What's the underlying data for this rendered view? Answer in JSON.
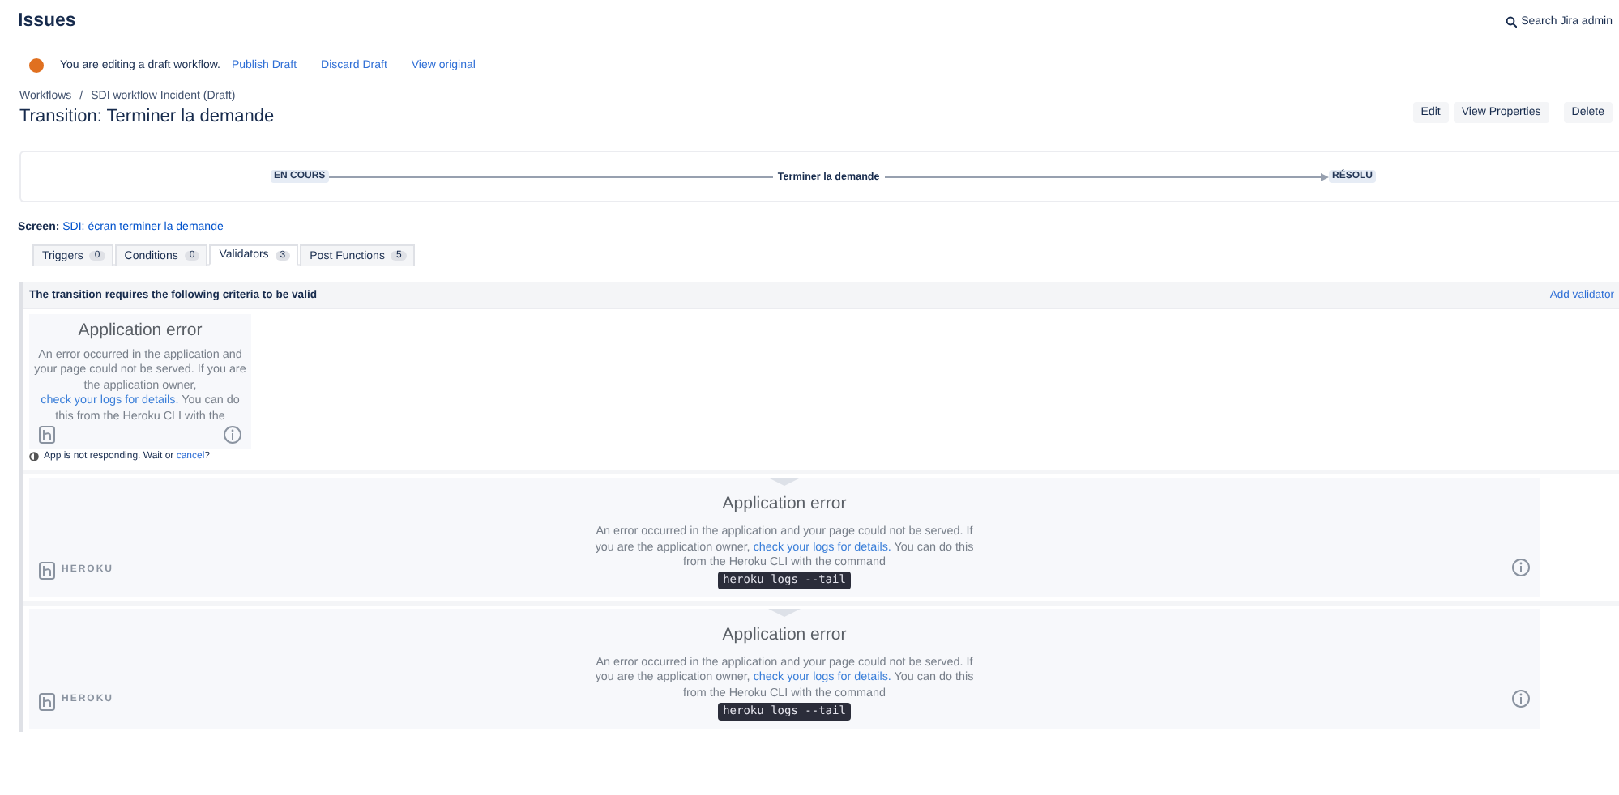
{
  "header": {
    "title": "Issues",
    "search": "Search Jira admin"
  },
  "draft_banner": {
    "message": "You are editing a draft workflow.",
    "actions": [
      "Publish Draft",
      "Discard Draft",
      "View original"
    ]
  },
  "breadcrumbs": {
    "separator": "/",
    "items": [
      "Workflows",
      "SDI workflow Incident (Draft)"
    ]
  },
  "page_title": "Transition: Terminer la demande",
  "actions": [
    "Edit",
    "View Properties",
    "Delete"
  ],
  "transition": {
    "from": "EN COURS",
    "label": "Terminer la demande",
    "to": "RÉSOLU"
  },
  "screen": {
    "label": "Screen:",
    "value": "SDI: écran terminer la demande"
  },
  "tabs": [
    {
      "label": "Triggers",
      "count": "0",
      "selected": false
    },
    {
      "label": "Conditions",
      "count": "0",
      "selected": false
    },
    {
      "label": "Validators",
      "count": "3",
      "selected": true
    },
    {
      "label": "Post Functions",
      "count": "5",
      "selected": false
    }
  ],
  "validators": {
    "heading": "The transition requires the following criteria to be valid",
    "add_link": "Add validator",
    "panels": [
      {
        "kind": "compact",
        "title": "Application error",
        "text": "An error occurred in the application and your page could not be served. If you are the application owner,",
        "link": "check your logs for details.",
        "text_after": "You can do this from the Heroku CLI with the"
      },
      {
        "kind": "full",
        "title": "Application error",
        "text": "An error occurred in the application and your page could not be served. If you are the application owner,",
        "link": "check your logs for details.",
        "text_after": "You can do this from the Heroku CLI with the command",
        "command": "heroku logs --tail",
        "brand": "HEROKU"
      },
      {
        "kind": "full",
        "title": "Application error",
        "text": "An error occurred in the application and your page could not be served. If you are the application owner,",
        "link": "check your logs for details.",
        "text_after": "You can do this from the Heroku CLI with the command",
        "command": "heroku logs --tail",
        "brand": "HEROKU"
      }
    ],
    "status": {
      "message": "App is not responding. Wait or",
      "link": "cancel",
      "after": "?"
    }
  }
}
